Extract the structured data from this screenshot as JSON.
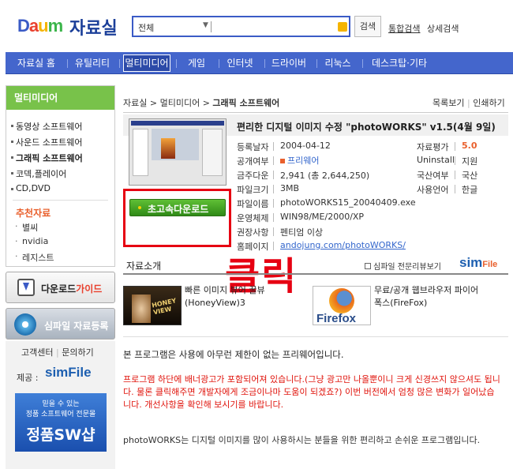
{
  "header": {
    "logo_text": {
      "d": "D",
      "a": "a",
      "u": "u",
      "m": "m"
    },
    "title": "자료실",
    "search": {
      "selected": "전체",
      "button": "검색"
    },
    "links": [
      "통합검색",
      "상세검색"
    ]
  },
  "nav": {
    "items": [
      "자료실 홈",
      "유틸리티",
      "멀티미디어",
      "게임",
      "인터넷",
      "드라이버",
      "리눅스",
      "데스크탑·기타"
    ],
    "active_index": 2
  },
  "sidebar": {
    "heading": "멀티미디어",
    "items": [
      "동영상 소프트웨어",
      "사운드 소프트웨어",
      "그래픽 소프트웨어",
      "코덱,플레이어",
      "CD,DVD"
    ],
    "bold_index": 2,
    "recommend_title": "추천자료",
    "recommend_items": [
      "별씨",
      "nvidia",
      "레지스트"
    ],
    "download_guide": {
      "prefix": "다운로드",
      "suffix": "가이드"
    },
    "simfile_register": "심파일 자료등록",
    "support_links": [
      "고객센터",
      "문의하기"
    ],
    "provided_label": "제공 :",
    "provider": "simFile",
    "ad": {
      "line1": "믿을 수 있는",
      "line2": "정품 소프트웨어 전문몰",
      "line3": "정품SW샵"
    }
  },
  "breadcrumb": {
    "items": [
      "자료실",
      "멀티미디어",
      "그래픽 소프트웨어"
    ],
    "actions": [
      "목록보기",
      "인쇄하기"
    ]
  },
  "program": {
    "title": "편리한 디지털 이미지 수정 \"photoWORKS\" v1.5(4월 9일)",
    "download_button": "초고속다운로드",
    "fields": [
      {
        "label": "등록날자",
        "value": "2004-04-12"
      },
      {
        "label": "공개여부",
        "value": "프리웨어"
      },
      {
        "label": "금주다운",
        "value": "2,941 (총 2,644,250)"
      },
      {
        "label": "파일크기",
        "value": "3MB"
      },
      {
        "label": "파일이름",
        "value": "photoWORKS15_20040409.exe"
      },
      {
        "label": "운영체제",
        "value": "WIN98/ME/2000/XP"
      },
      {
        "label": "권장사항",
        "value": "펜티엄 이상"
      },
      {
        "label": "홈페이지",
        "value": "andojung.com/photoWORKS/"
      }
    ],
    "side_fields": [
      {
        "label": "자료평가",
        "value": "5.0"
      },
      {
        "label": "Uninstall",
        "value": "지원"
      },
      {
        "label": "국산여부",
        "value": "국산"
      },
      {
        "label": "사용언어",
        "value": "한글"
      }
    ],
    "rating_color": "#e9602d"
  },
  "annotation": {
    "click_text": "클릭"
  },
  "intro": {
    "heading": "자료소개",
    "simfile_review": "심파일 전문리뷰보기",
    "sim_logo": "sim",
    "sim_logo_suffix": "File",
    "related": [
      {
        "title": "빠른 이미지 뷰어 꿀뷰",
        "sub": "(HoneyView)3",
        "thumb_text": "HONEY VIEW"
      },
      {
        "title": "무료/공개 웹브라우저 파이어",
        "sub": "폭스(FireFox)",
        "thumb_text": "Firefox"
      }
    ],
    "para1": "본 프로그램은 사용에 아무런 제한이 없는 프리웨어입니다.",
    "para2": "프로그램 하단에 배너광고가 포함되어져 있습니다.(그냥 광고만 나올뿐이니 크게 신경쓰지 않으셔도 됩니다. 물론 클릭해주면 개발자에게 조금이나마 도움이 되겠죠?) 이번 버전에서 엄청 많은 변화가 일어났습니다. 개선사항을 확인해 보시기를 바랍니다.",
    "para3": "photoWORKS는 디지털 이미지를 많이 사용하시는 분들을 위한 편리하고 손쉬운 프로그램입니다."
  }
}
